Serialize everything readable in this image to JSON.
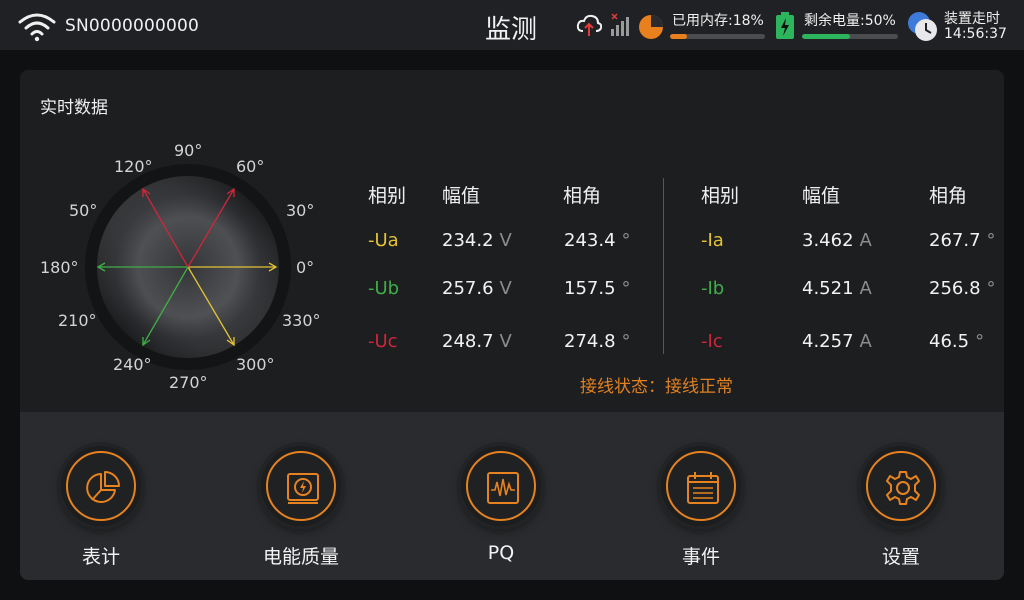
{
  "status": {
    "serial": "SN0000000000",
    "title": "监测",
    "memory_label": "已用内存:18%",
    "memory_percent": 18,
    "battery_label": "剩余电量:50%",
    "battery_percent": 50,
    "runtime_label": "装置走时",
    "runtime_value": "14:56:37"
  },
  "colors": {
    "accent": "#e6821f",
    "phase_a": "#e3c234",
    "phase_b": "#3fae47",
    "phase_c": "#d0263b"
  },
  "card": {
    "title": "实时数据",
    "angle_labels": [
      "90°",
      "120°",
      "60°",
      "50°",
      "30°",
      "180°",
      "0°",
      "210°",
      "330°",
      "240°",
      "300°",
      "270°"
    ],
    "voltage_headers": [
      "相别",
      "幅值",
      "相角"
    ],
    "current_headers": [
      "相别",
      "幅值",
      "相角"
    ],
    "voltage_rows": [
      {
        "phase": "-Ua",
        "value": "234.2",
        "unit": "V",
        "angle": "243.4",
        "angle_unit": "°"
      },
      {
        "phase": "-Ub",
        "value": "257.6",
        "unit": "V",
        "angle": "157.5",
        "angle_unit": "°"
      },
      {
        "phase": "-Uc",
        "value": "248.7",
        "unit": "V",
        "angle": "274.8",
        "angle_unit": "°"
      }
    ],
    "current_rows": [
      {
        "phase": "-Ia",
        "value": "3.462",
        "unit": "A",
        "angle": "267.7",
        "angle_unit": "°"
      },
      {
        "phase": "-Ib",
        "value": "4.521",
        "unit": "A",
        "angle": "256.8",
        "angle_unit": "°"
      },
      {
        "phase": "-Ic",
        "value": "4.257",
        "unit": "A",
        "angle": "46.5",
        "angle_unit": "°"
      }
    ],
    "wiring_status": "接线状态：接线正常"
  },
  "nav": [
    {
      "label": "表计",
      "icon": "pie-chart-icon"
    },
    {
      "label": "电能质量",
      "icon": "lightning-icon"
    },
    {
      "label": "PQ",
      "icon": "waveform-icon"
    },
    {
      "label": "事件",
      "icon": "calendar-icon"
    },
    {
      "label": "设置",
      "icon": "gear-icon"
    }
  ]
}
